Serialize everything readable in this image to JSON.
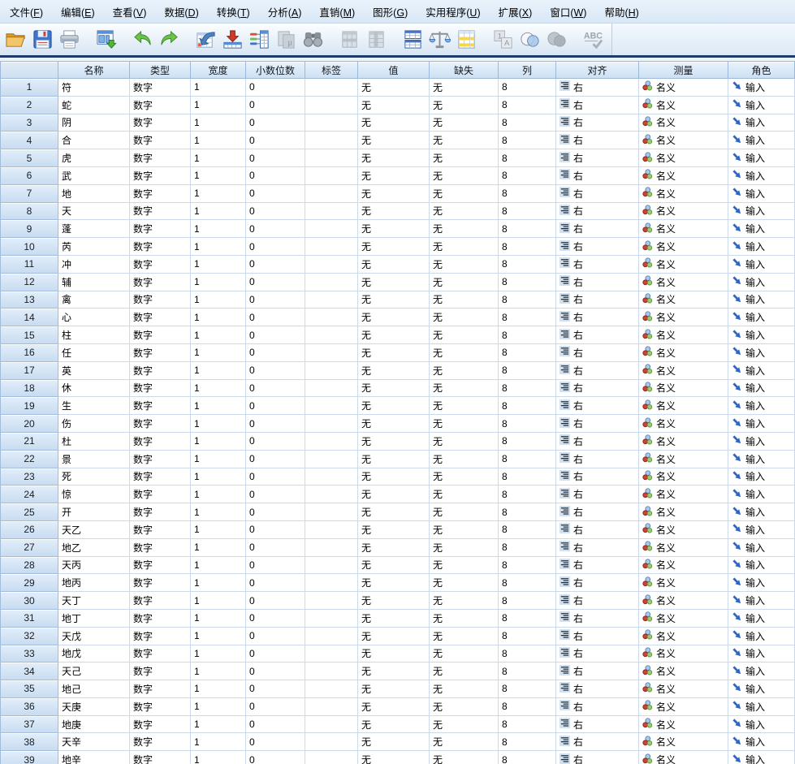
{
  "menu": {
    "items": [
      {
        "id": "file",
        "pre": "文件(",
        "mnemonic": "F",
        "post": ")"
      },
      {
        "id": "edit",
        "pre": "编辑(",
        "mnemonic": "E",
        "post": ")"
      },
      {
        "id": "view",
        "pre": "查看(",
        "mnemonic": "V",
        "post": ")"
      },
      {
        "id": "data",
        "pre": "数据(",
        "mnemonic": "D",
        "post": ")"
      },
      {
        "id": "transform",
        "pre": "转换(",
        "mnemonic": "T",
        "post": ")"
      },
      {
        "id": "analyze",
        "pre": "分析(",
        "mnemonic": "A",
        "post": ")"
      },
      {
        "id": "direct-marketing",
        "pre": "直销(",
        "mnemonic": "M",
        "post": ")"
      },
      {
        "id": "graphs",
        "pre": "图形(",
        "mnemonic": "G",
        "post": ")"
      },
      {
        "id": "utilities",
        "pre": "实用程序(",
        "mnemonic": "U",
        "post": ")"
      },
      {
        "id": "extensions",
        "pre": "扩展(",
        "mnemonic": "X",
        "post": ")"
      },
      {
        "id": "window",
        "pre": "窗口(",
        "mnemonic": "W",
        "post": ")"
      },
      {
        "id": "help",
        "pre": "帮助(",
        "mnemonic": "H",
        "post": ")"
      }
    ]
  },
  "toolbar": {
    "buttons": [
      {
        "icon": "open-folder-icon",
        "enabled": true
      },
      {
        "icon": "save-icon",
        "enabled": true
      },
      {
        "icon": "print-icon",
        "enabled": true
      },
      {
        "icon": "recall-dialogs-icon",
        "enabled": true
      },
      {
        "icon": "undo-icon",
        "enabled": true
      },
      {
        "icon": "redo-icon",
        "enabled": true
      },
      {
        "icon": "goto-case-icon",
        "enabled": true
      },
      {
        "icon": "goto-variable-icon",
        "enabled": true
      },
      {
        "icon": "variables-icon",
        "enabled": true
      },
      {
        "icon": "descriptives-icon",
        "enabled": false
      },
      {
        "icon": "find-icon",
        "enabled": true
      },
      {
        "icon": "insert-cases-icon",
        "enabled": false
      },
      {
        "icon": "insert-variable-icon",
        "enabled": false
      },
      {
        "icon": "split-file-icon",
        "enabled": true
      },
      {
        "icon": "weight-cases-icon",
        "enabled": true
      },
      {
        "icon": "select-cases-icon",
        "enabled": true
      },
      {
        "icon": "value-labels-icon",
        "enabled": false
      },
      {
        "icon": "use-variable-sets-icon",
        "enabled": true
      },
      {
        "icon": "show-all-variables-icon",
        "enabled": false
      },
      {
        "icon": "spell-check-icon",
        "enabled": false
      }
    ]
  },
  "table": {
    "columns": [
      {
        "id": "name",
        "label": "名称"
      },
      {
        "id": "type",
        "label": "类型"
      },
      {
        "id": "width",
        "label": "宽度"
      },
      {
        "id": "decimals",
        "label": "小数位数"
      },
      {
        "id": "label",
        "label": "标签"
      },
      {
        "id": "values",
        "label": "值"
      },
      {
        "id": "missing",
        "label": "缺失"
      },
      {
        "id": "columns",
        "label": "列"
      },
      {
        "id": "align",
        "label": "对齐"
      },
      {
        "id": "measure",
        "label": "测量"
      },
      {
        "id": "role",
        "label": "角色"
      }
    ],
    "defaults": {
      "type": "数字",
      "width": "1",
      "decimals": "0",
      "label": "",
      "values": "无",
      "missing": "无",
      "columns": "8",
      "align": "右",
      "measure": "名义",
      "role": "输入"
    },
    "icons": {
      "align": "align-right-icon",
      "measure": "nominal-measure-icon",
      "role": "input-role-icon"
    },
    "rows": [
      {
        "num": "1",
        "name": "符"
      },
      {
        "num": "2",
        "name": "蛇"
      },
      {
        "num": "3",
        "name": "阴"
      },
      {
        "num": "4",
        "name": "合"
      },
      {
        "num": "5",
        "name": "虎"
      },
      {
        "num": "6",
        "name": "武"
      },
      {
        "num": "7",
        "name": "地"
      },
      {
        "num": "8",
        "name": "天"
      },
      {
        "num": "9",
        "name": "蓬"
      },
      {
        "num": "10",
        "name": "芮"
      },
      {
        "num": "11",
        "name": "冲"
      },
      {
        "num": "12",
        "name": "辅"
      },
      {
        "num": "13",
        "name": "禽"
      },
      {
        "num": "14",
        "name": "心"
      },
      {
        "num": "15",
        "name": "柱"
      },
      {
        "num": "16",
        "name": "任"
      },
      {
        "num": "17",
        "name": "英"
      },
      {
        "num": "18",
        "name": "休"
      },
      {
        "num": "19",
        "name": "生"
      },
      {
        "num": "20",
        "name": "伤"
      },
      {
        "num": "21",
        "name": "杜"
      },
      {
        "num": "22",
        "name": "景"
      },
      {
        "num": "23",
        "name": "死"
      },
      {
        "num": "24",
        "name": "惊"
      },
      {
        "num": "25",
        "name": "开"
      },
      {
        "num": "26",
        "name": "天乙"
      },
      {
        "num": "27",
        "name": "地乙"
      },
      {
        "num": "28",
        "name": "天丙"
      },
      {
        "num": "29",
        "name": "地丙"
      },
      {
        "num": "30",
        "name": "天丁"
      },
      {
        "num": "31",
        "name": "地丁"
      },
      {
        "num": "32",
        "name": "天戊"
      },
      {
        "num": "33",
        "name": "地戊"
      },
      {
        "num": "34",
        "name": "天己"
      },
      {
        "num": "35",
        "name": "地己"
      },
      {
        "num": "36",
        "name": "天庚"
      },
      {
        "num": "37",
        "name": "地庚"
      },
      {
        "num": "38",
        "name": "天辛"
      },
      {
        "num": "39",
        "name": "地辛"
      }
    ]
  }
}
